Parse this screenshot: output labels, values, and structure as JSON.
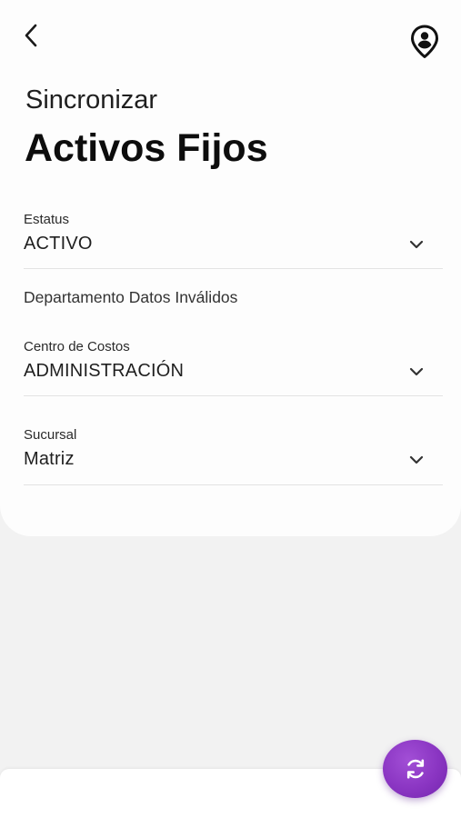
{
  "header": {
    "back_icon": "chevron-left-icon",
    "profile_icon": "user-location-pin-icon",
    "subtitle": "Sincronizar",
    "title": "Activos Fijos"
  },
  "form": {
    "estatus": {
      "label": "Estatus",
      "value": "ACTIVO",
      "icon": "chevron-down-icon"
    },
    "departamento": {
      "text": "Departamento Datos Inválidos"
    },
    "centro_costos": {
      "label": "Centro de Costos",
      "value": "ADMINISTRACIÓN",
      "icon": "chevron-down-icon"
    },
    "sucursal": {
      "label": "Sucursal",
      "value": "Matriz",
      "icon": "chevron-down-icon"
    }
  },
  "fab": {
    "icon": "sync-icon",
    "color": "#8a35c2"
  },
  "colors": {
    "background": "#f2f2f2",
    "card": "#fdfdfd",
    "divider": "#e3e3e3",
    "accent": "#8a35c2"
  }
}
